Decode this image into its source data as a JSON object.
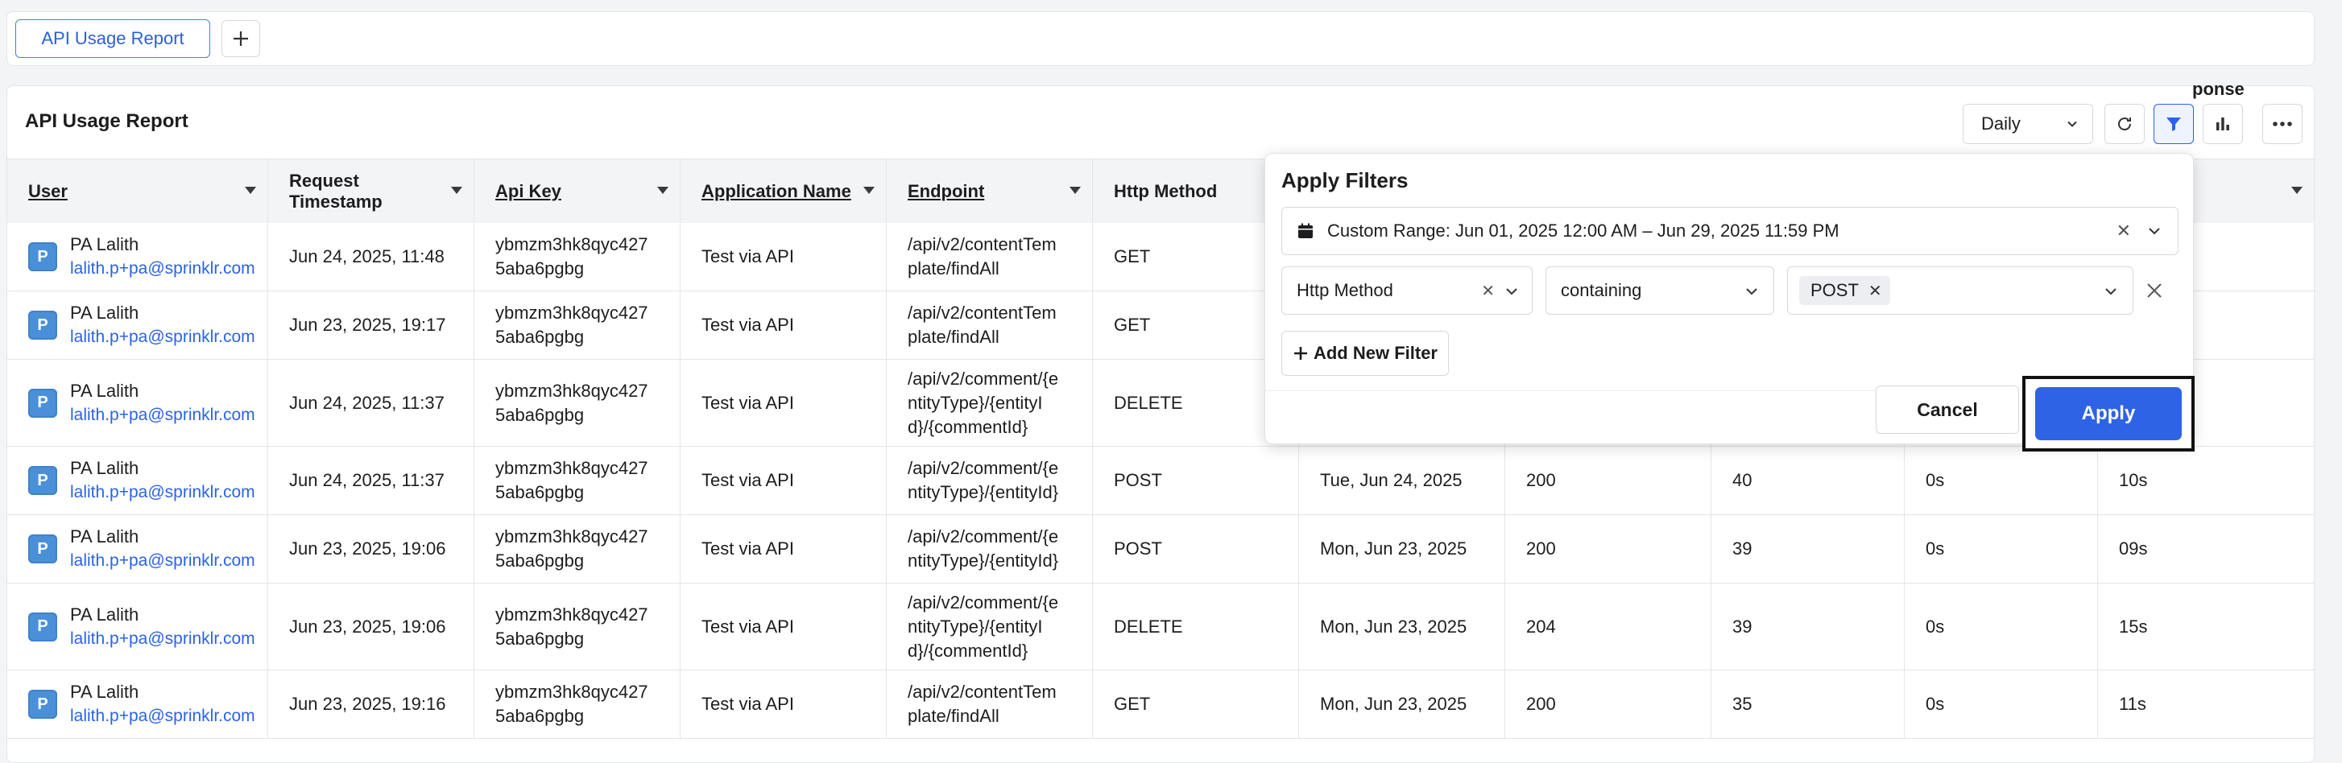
{
  "tabs": {
    "active_label": "API Usage Report"
  },
  "report": {
    "title": "API Usage Report",
    "frequency": "Daily"
  },
  "columns": [
    {
      "label": "User",
      "underline": true
    },
    {
      "label": "Request Timestamp",
      "underline": false
    },
    {
      "label": "Api Key",
      "underline": true
    },
    {
      "label": "Application Name",
      "underline": true
    },
    {
      "label": "Endpoint",
      "underline": true
    },
    {
      "label": "Http Method",
      "underline": false
    },
    {
      "label": "",
      "underline": false
    },
    {
      "label": "",
      "underline": false
    },
    {
      "label": "",
      "underline": false
    },
    {
      "label": "",
      "underline": false
    },
    {
      "label": "ponse",
      "underline": false
    }
  ],
  "rows": [
    {
      "name": "PA Lalith",
      "email": "lalith.p+pa@sprinklr.com",
      "timestamp": "Jun 24, 2025, 11:48",
      "api_key": [
        "ybmzm3hk8qyc427",
        "5aba6pgbg"
      ],
      "app": "Test via API",
      "endpoint": [
        "/api/v2/contentTem",
        "plate/findAll"
      ],
      "method": "GET",
      "date": "",
      "status": "",
      "c9": "",
      "c10": "",
      "c11": ""
    },
    {
      "name": "PA Lalith",
      "email": "lalith.p+pa@sprinklr.com",
      "timestamp": "Jun 23, 2025, 19:17",
      "api_key": [
        "ybmzm3hk8qyc427",
        "5aba6pgbg"
      ],
      "app": "Test via API",
      "endpoint": [
        "/api/v2/contentTem",
        "plate/findAll"
      ],
      "method": "GET",
      "date": "",
      "status": "",
      "c9": "",
      "c10": "",
      "c11": ""
    },
    {
      "name": "PA Lalith",
      "email": "lalith.p+pa@sprinklr.com",
      "timestamp": "Jun 24, 2025, 11:37",
      "api_key": [
        "ybmzm3hk8qyc427",
        "5aba6pgbg"
      ],
      "app": "Test via API",
      "endpoint": [
        "/api/v2/comment/{e",
        "ntityType}/{entityI",
        "d}/{commentId}"
      ],
      "method": "DELETE",
      "date": "",
      "status": "",
      "c9": "",
      "c10": "",
      "c11": ""
    },
    {
      "name": "PA Lalith",
      "email": "lalith.p+pa@sprinklr.com",
      "timestamp": "Jun 24, 2025, 11:37",
      "api_key": [
        "ybmzm3hk8qyc427",
        "5aba6pgbg"
      ],
      "app": "Test via API",
      "endpoint": [
        "/api/v2/comment/{e",
        "ntityType}/{entityId}"
      ],
      "method": "POST",
      "date": "Tue, Jun 24, 2025",
      "status": "200",
      "c9": "40",
      "c10": "0s",
      "c11": "10s"
    },
    {
      "name": "PA Lalith",
      "email": "lalith.p+pa@sprinklr.com",
      "timestamp": "Jun 23, 2025, 19:06",
      "api_key": [
        "ybmzm3hk8qyc427",
        "5aba6pgbg"
      ],
      "app": "Test via API",
      "endpoint": [
        "/api/v2/comment/{e",
        "ntityType}/{entityId}"
      ],
      "method": "POST",
      "date": "Mon, Jun 23, 2025",
      "status": "200",
      "c9": "39",
      "c10": "0s",
      "c11": "09s"
    },
    {
      "name": "PA Lalith",
      "email": "lalith.p+pa@sprinklr.com",
      "timestamp": "Jun 23, 2025, 19:06",
      "api_key": [
        "ybmzm3hk8qyc427",
        "5aba6pgbg"
      ],
      "app": "Test via API",
      "endpoint": [
        "/api/v2/comment/{e",
        "ntityType}/{entityI",
        "d}/{commentId}"
      ],
      "method": "DELETE",
      "date": "Mon, Jun 23, 2025",
      "status": "204",
      "c9": "39",
      "c10": "0s",
      "c11": "15s"
    },
    {
      "name": "PA Lalith",
      "email": "lalith.p+pa@sprinklr.com",
      "timestamp": "Jun 23, 2025, 19:16",
      "api_key": [
        "ybmzm3hk8qyc427",
        "5aba6pgbg"
      ],
      "app": "Test via API",
      "endpoint": [
        "/api/v2/contentTem",
        "plate/findAll"
      ],
      "method": "GET",
      "date": "Mon, Jun 23, 2025",
      "status": "200",
      "c9": "35",
      "c10": "0s",
      "c11": "11s"
    }
  ],
  "filters": {
    "title": "Apply Filters",
    "date_range": "Custom Range: Jun 01, 2025 12:00 AM – Jun 29, 2025 11:59 PM",
    "field": "Http Method",
    "operator": "containing",
    "values": [
      "POST"
    ],
    "add_label": "Add New Filter",
    "cancel_label": "Cancel",
    "apply_label": "Apply"
  },
  "colors": {
    "accent": "#2f63e6",
    "link": "#2b63e8",
    "avatar": "#4a90d9"
  },
  "icons": [
    "plus-icon",
    "chevron-down-icon",
    "refresh-icon",
    "filter-icon",
    "bar-chart-icon",
    "more-icon",
    "calendar-icon",
    "close-icon",
    "sort-caret-icon"
  ]
}
